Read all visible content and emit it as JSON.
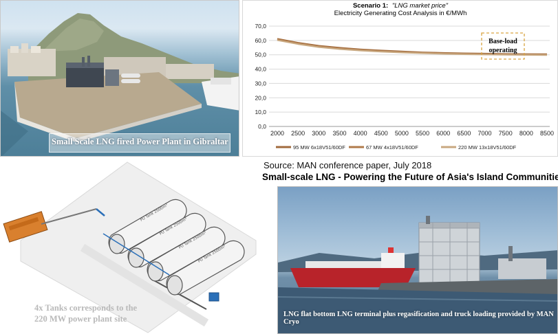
{
  "gibraltar_caption": "Small Scale LNG fired Power Plant in Gibraltar",
  "source_text": "Source: MAN conference paper, July 2018",
  "headline": "Small-scale LNG - Powering the Future of Asia's Island Communities",
  "tanks_caption_line1": "4x Tanks corresponds to the",
  "tanks_caption_line2": "220 MW power plant site",
  "tank_labels": [
    "PU Tank 2500m³",
    "PU Tank 2500m³",
    "PU Tank 2500m³",
    "PU Tank 2500m³"
  ],
  "terminal_caption": "LNG flat bottom LNG terminal plus regasification and truck loading provided by MAN Cryo",
  "chart_data": {
    "type": "line",
    "title_prefix": "Scenario 1:",
    "title_italic": "\"LNG market price\"",
    "subtitle": "Electricity Generating Cost Analysis in €/MWh",
    "x": [
      2000,
      2500,
      3000,
      3500,
      4000,
      4500,
      5000,
      5500,
      6000,
      6500,
      7000,
      7500,
      8000,
      8500
    ],
    "ylim": [
      0,
      70
    ],
    "yticks": [
      "0,0",
      "10,0",
      "20,0",
      "30,0",
      "40,0",
      "50,0",
      "60,0",
      "70,0"
    ],
    "grid": true,
    "legend_position": "bottom",
    "annotation": "Base-load operating",
    "annotation_lines": [
      "Base-load",
      "operating"
    ],
    "series": [
      {
        "name": "95 MW 6x18V51/60DF",
        "color": "#a06a3c",
        "values": [
          61.2,
          58.4,
          56.3,
          54.9,
          53.8,
          53.0,
          52.3,
          51.7,
          51.3,
          51.0,
          50.8,
          50.6,
          50.5,
          50.4
        ]
      },
      {
        "name": "67 MW 4x18V51/60DF",
        "color": "#b07a4a",
        "values": [
          60.8,
          58.0,
          55.9,
          54.5,
          53.4,
          52.6,
          51.9,
          51.4,
          51.0,
          50.7,
          50.5,
          50.3,
          50.2,
          50.1
        ]
      },
      {
        "name": "220 MW 13x18V51/60DF",
        "color": "#c8a880",
        "values": [
          60.2,
          57.5,
          55.4,
          54.0,
          53.0,
          52.2,
          51.6,
          51.1,
          50.7,
          50.4,
          50.2,
          50.0,
          49.9,
          49.8
        ]
      }
    ]
  }
}
